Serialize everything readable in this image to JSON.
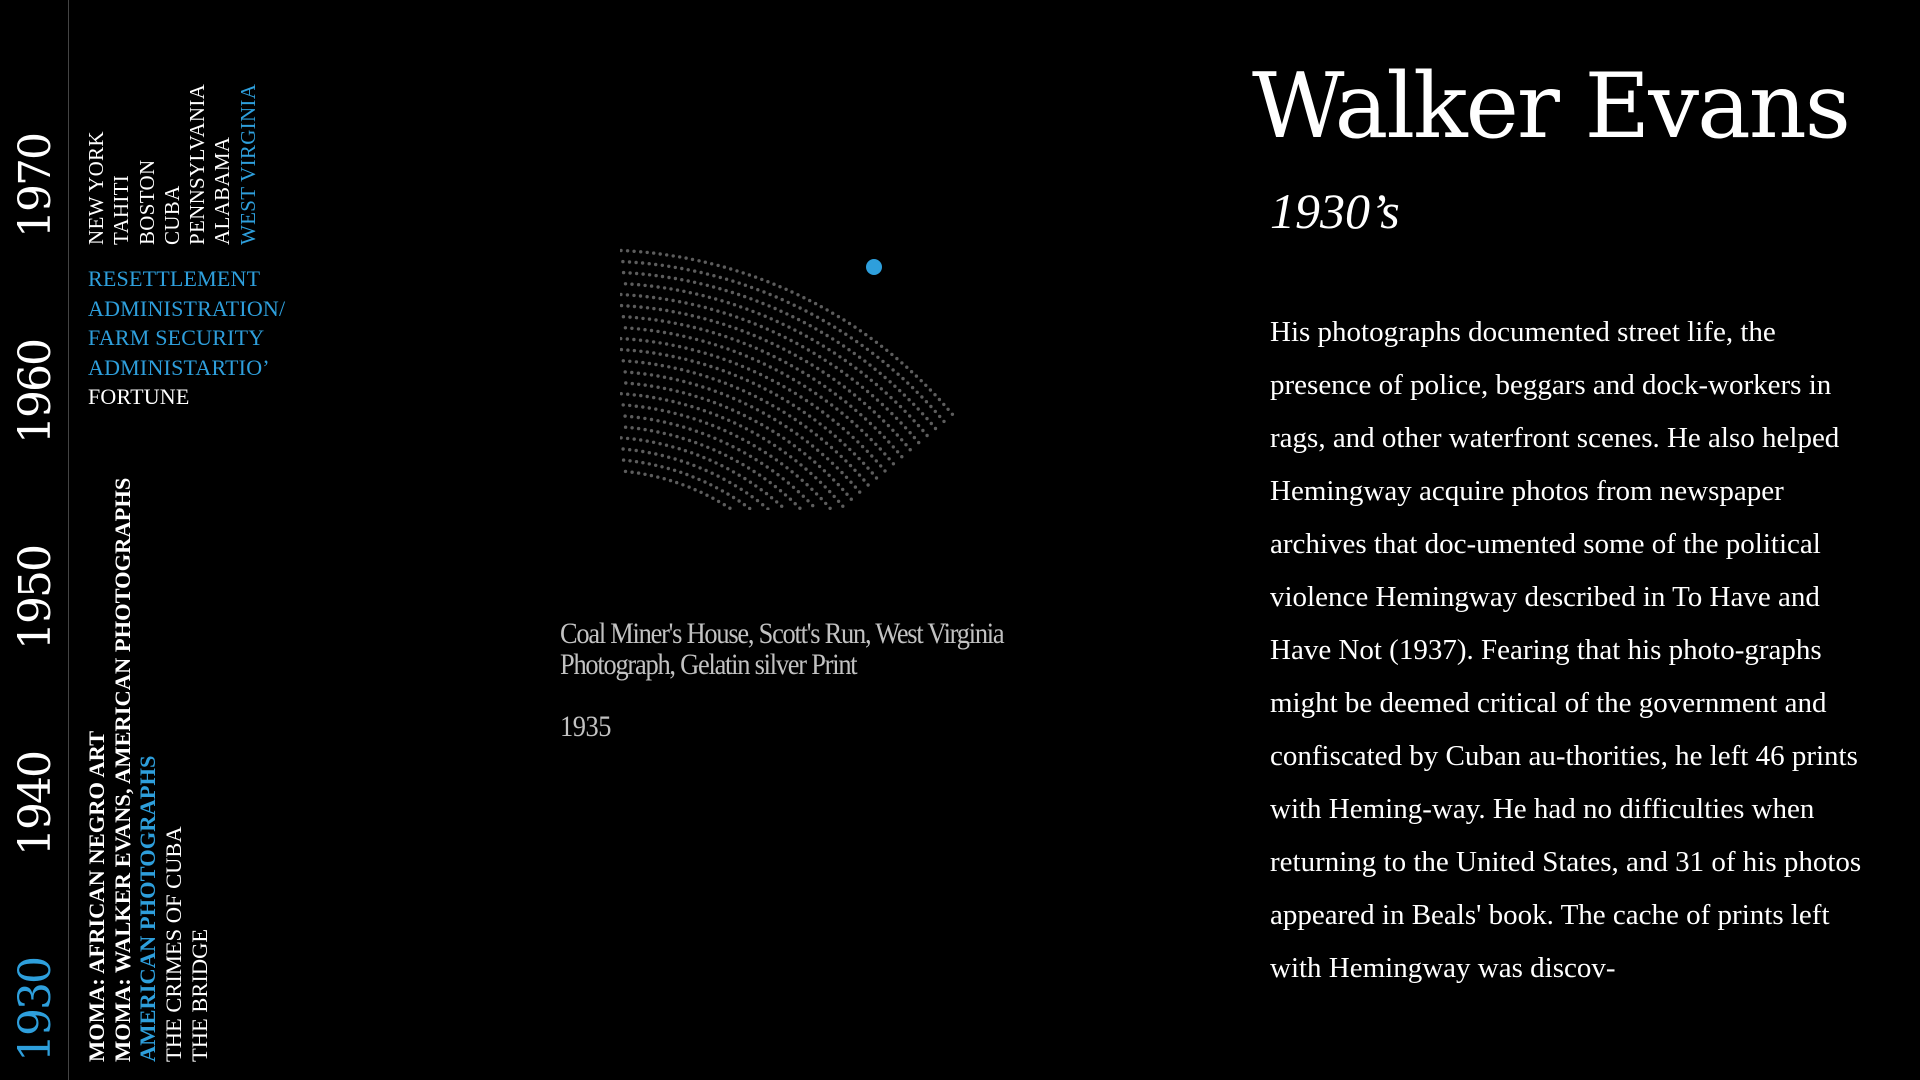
{
  "timeline": {
    "decades": [
      {
        "label": "1970",
        "active": false
      },
      {
        "label": "1960",
        "active": false
      },
      {
        "label": "1950",
        "active": false
      },
      {
        "label": "1940",
        "active": false
      },
      {
        "label": "1930",
        "active": true
      }
    ]
  },
  "locations": [
    "NEW YORK",
    "TAHITI",
    "BOSTON",
    "CUBA",
    "PENNSYLVANIA",
    "ALABAMA",
    "WEST VIRGINIA"
  ],
  "locations_active_index": 6,
  "projects": [
    {
      "label": "RESETTLEMENT ADMINISTRATION/ FARM SECURITY ADMINISTARTIO’",
      "active": true
    },
    {
      "label": "FORTUNE",
      "active": false
    }
  ],
  "exhibitions": [
    {
      "label": "MOMA: AFRICAN NEGRO ART",
      "bold": true,
      "active": false
    },
    {
      "label": "MOMA: WALKER EVANS, AMERICAN PHOTOGRAPHS",
      "bold": true,
      "active": false
    },
    {
      "label": "AMERICAN PHOTOGRAPHS",
      "bold": true,
      "active": true
    },
    {
      "label": "THE CRIMES OF CUBA",
      "bold": false,
      "active": false
    },
    {
      "label": "THE BRIDGE",
      "bold": false,
      "active": false
    }
  ],
  "artwork": {
    "caption_line1": "Coal Miner's House, Scott's Run, West Virginia",
    "caption_line2": "Photograph, Gelatin silver Print",
    "year": "1935"
  },
  "artist": {
    "name": "Walker Evans",
    "period": "1930’s",
    "bio": "His photographs documented street life, the presence of police, beggars and dock-workers in rags, and other waterfront scenes. He also helped Hemingway acquire photos from newspaper archives that doc-umented some of the political violence Hemingway described in To Have and Have Not (1937). Fearing that his photo-graphs might be deemed critical of the government and confiscated by Cuban au-thorities, he left 46 prints with Heming-way. He had no difficulties when returning to the United States, and 31 of his photos appeared in Beals' book. The cache of prints left with Hemingway was discov-"
  },
  "colors": {
    "accent": "#2e9fdc",
    "dot": "#5d5d5d",
    "caption": "#c2c2c2",
    "background": "#000000"
  }
}
